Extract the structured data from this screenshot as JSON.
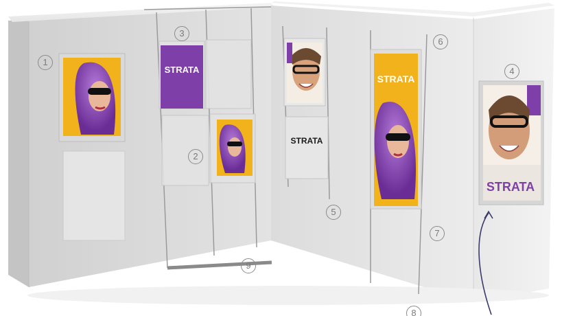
{
  "brand": {
    "name": "STRATA",
    "accent_purple": "#7f3fa8",
    "accent_yellow": "#f2b21b"
  },
  "markers": [
    {
      "id": "1",
      "label": "1"
    },
    {
      "id": "2",
      "label": "2"
    },
    {
      "id": "3",
      "label": "3"
    },
    {
      "id": "4",
      "label": "4"
    },
    {
      "id": "5",
      "label": "5"
    },
    {
      "id": "6",
      "label": "6"
    },
    {
      "id": "7",
      "label": "7"
    },
    {
      "id": "8",
      "label": "8"
    },
    {
      "id": "9",
      "label": "9"
    }
  ],
  "posters": {
    "left_panel_text": "STRATA",
    "mid_white_text": "STRATA",
    "tall_poster_text": "STRATA",
    "right_wall_text": "STRATA"
  }
}
